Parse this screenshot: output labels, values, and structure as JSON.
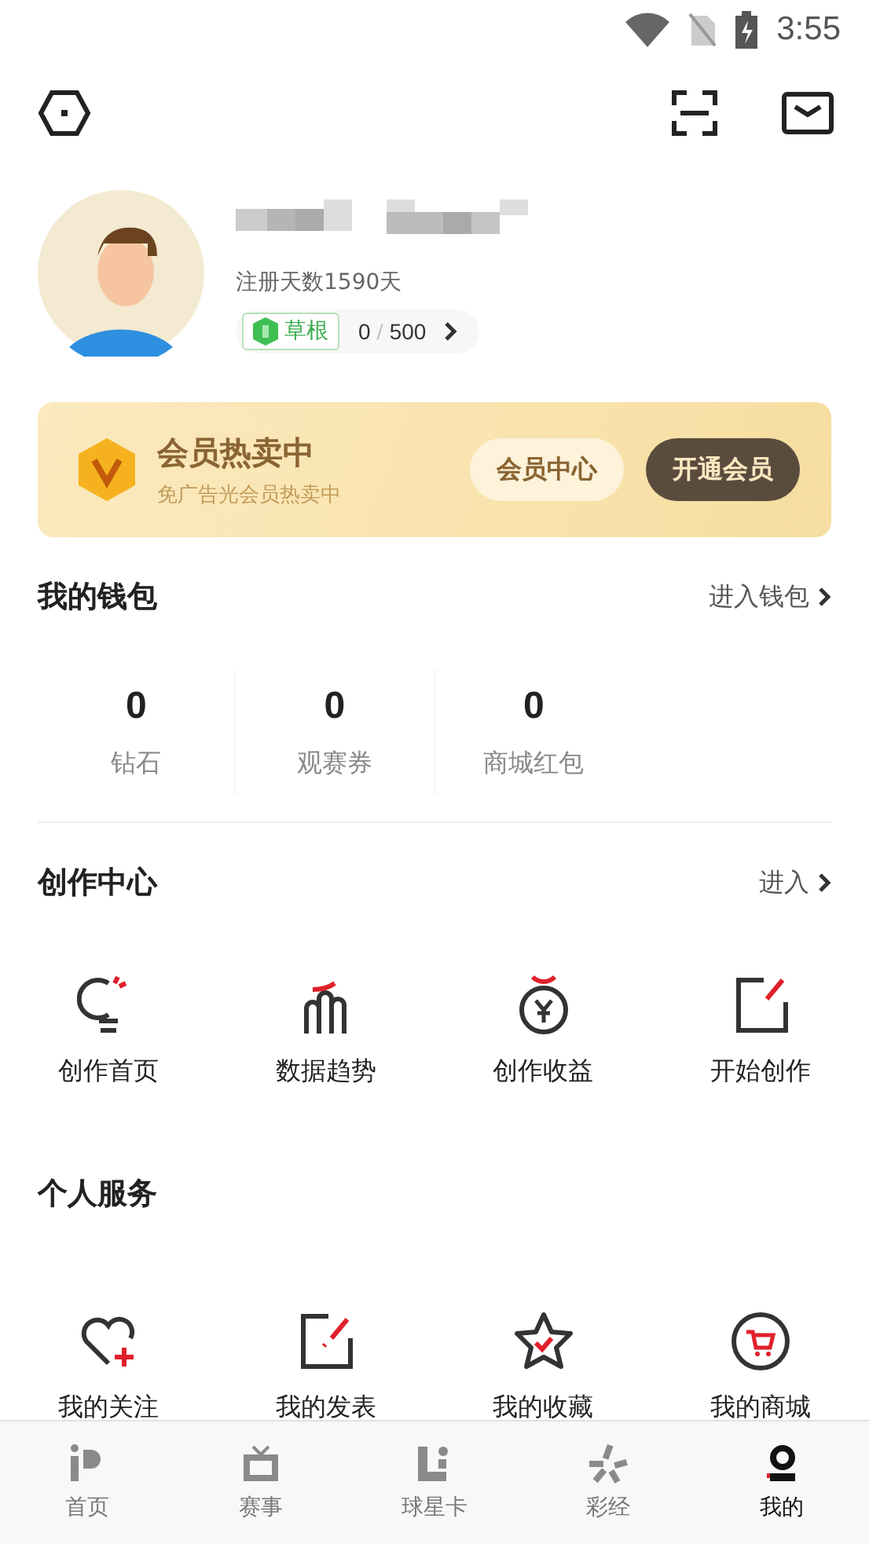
{
  "status_bar": {
    "time": "3:55"
  },
  "profile": {
    "register_days": "注册天数1590天",
    "level_badge": "草根",
    "points": "0",
    "points_total": "500",
    "points_separator": "/"
  },
  "vip_banner": {
    "title": "会员热卖中",
    "subtitle": "免广告光会员热卖中",
    "buttons": [
      {
        "label": "会员中心",
        "kind": "light"
      },
      {
        "label": "开通会员",
        "kind": "dark"
      }
    ]
  },
  "wallet": {
    "title": "我的钱包",
    "link": "进入钱包",
    "items": [
      {
        "value": "0",
        "label": "钻石"
      },
      {
        "value": "0",
        "label": "观赛券"
      },
      {
        "value": "0",
        "label": "商城红包"
      }
    ]
  },
  "creation": {
    "title": "创作中心",
    "link": "进入",
    "items": [
      {
        "label": "创作首页",
        "kind": "bulb"
      },
      {
        "label": "数据趋势",
        "kind": "chart"
      },
      {
        "label": "创作收益",
        "kind": "coin"
      },
      {
        "label": "开始创作",
        "kind": "edit"
      }
    ]
  },
  "services": {
    "title": "个人服务",
    "items": [
      {
        "label": "我的关注",
        "kind": "follow"
      },
      {
        "label": "我的发表",
        "kind": "post"
      },
      {
        "label": "我的收藏",
        "kind": "star"
      },
      {
        "label": "我的商城",
        "kind": "cart"
      }
    ]
  },
  "tab_bar": [
    {
      "label": "首页",
      "kind": "home",
      "selected": false
    },
    {
      "label": "赛事",
      "kind": "tv",
      "selected": false
    },
    {
      "label": "球星卡",
      "kind": "card",
      "selected": false
    },
    {
      "label": "彩经",
      "kind": "lottery",
      "selected": false
    },
    {
      "label": "我的",
      "kind": "me",
      "selected": true
    }
  ]
}
